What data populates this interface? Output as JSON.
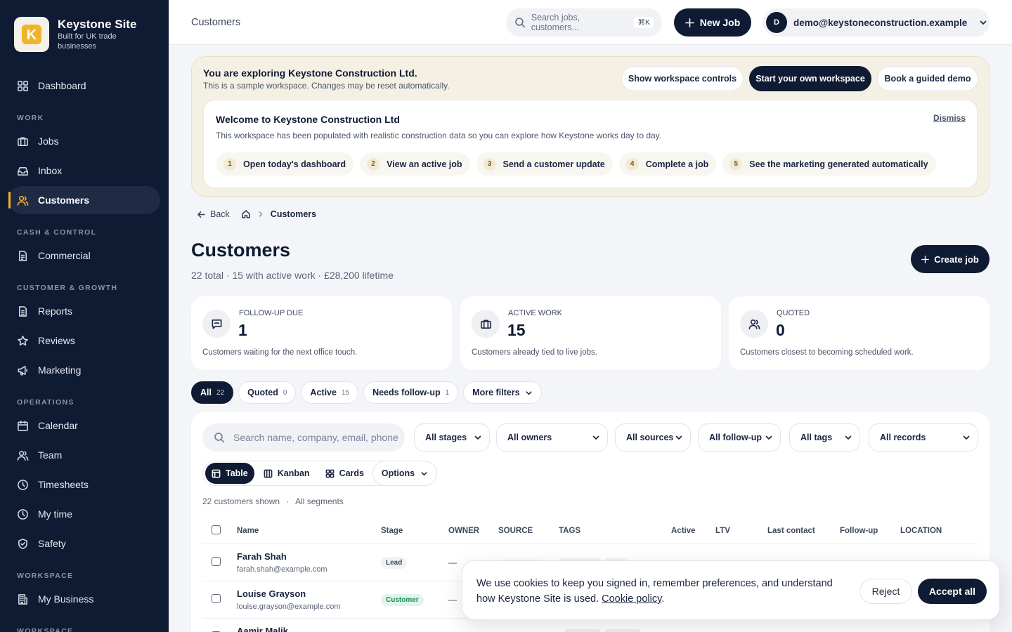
{
  "brand": {
    "name": "Keystone Site",
    "tagline": "Built for UK trade businesses",
    "logo_letter": "K"
  },
  "nav": {
    "dashboard": "Dashboard",
    "section_work": "WORK",
    "jobs": "Jobs",
    "inbox": "Inbox",
    "customers": "Customers",
    "section_cash": "CASH & CONTROL",
    "commercial": "Commercial",
    "section_growth": "CUSTOMER & GROWTH",
    "reports": "Reports",
    "reviews": "Reviews",
    "marketing": "Marketing",
    "section_ops": "OPERATIONS",
    "calendar": "Calendar",
    "team": "Team",
    "timesheets": "Timesheets",
    "my_time": "My time",
    "safety": "Safety",
    "section_workspace": "WORKSPACE",
    "my_business": "My Business",
    "section_workspace2": "WORKSPACE"
  },
  "topbar": {
    "title": "Customers",
    "search_placeholder": "Search jobs, customers...",
    "search_shortcut": "⌘K",
    "new_job": "New Job",
    "user_initial": "D",
    "user_email": "demo@keystoneconstruction.example"
  },
  "demo": {
    "title": "You are exploring Keystone Construction Ltd.",
    "subtitle": "This is a sample workspace. Changes may be reset automatically.",
    "btn_controls": "Show workspace controls",
    "btn_start": "Start your own workspace",
    "btn_demo": "Book a guided demo",
    "welcome_title": "Welcome to Keystone Construction Ltd",
    "welcome_sub": "This workspace has been populated with realistic construction data so you can explore how Keystone works day to day.",
    "dismiss": "Dismiss",
    "steps": [
      {
        "num": "1",
        "label": "Open today's dashboard"
      },
      {
        "num": "2",
        "label": "View an active job"
      },
      {
        "num": "3",
        "label": "Send a customer update"
      },
      {
        "num": "4",
        "label": "Complete a job"
      },
      {
        "num": "5",
        "label": "See the marketing generated automatically"
      }
    ]
  },
  "breadcrumb": {
    "back": "Back",
    "current": "Customers"
  },
  "page": {
    "title": "Customers",
    "subtitle": "22 total · 15 with active work · £28,200 lifetime",
    "create_job": "Create job"
  },
  "stats": [
    {
      "label": "FOLLOW-UP DUE",
      "value": "1",
      "desc": "Customers waiting for the next office touch."
    },
    {
      "label": "ACTIVE WORK",
      "value": "15",
      "desc": "Customers already tied to live jobs."
    },
    {
      "label": "QUOTED",
      "value": "0",
      "desc": "Customers closest to becoming scheduled work."
    }
  ],
  "chips": [
    {
      "label": "All",
      "count": "22"
    },
    {
      "label": "Quoted",
      "count": "0"
    },
    {
      "label": "Active",
      "count": "15"
    },
    {
      "label": "Needs follow-up",
      "count": "1"
    },
    {
      "label": "More filters",
      "count": ""
    }
  ],
  "filters": {
    "search_placeholder": "Search name, company, email, phone",
    "stages": "All stages",
    "owners": "All owners",
    "sources": "All sources",
    "followup": "All follow-up",
    "tags": "All tags",
    "records": "All records"
  },
  "views": {
    "table": "Table",
    "kanban": "Kanban",
    "cards": "Cards",
    "options": "Options"
  },
  "shown": {
    "count": "22 customers shown",
    "segment": "All segments"
  },
  "columns": {
    "name": "Name",
    "stage": "Stage",
    "owner": "OWNER",
    "source": "SOURCE",
    "tags": "TAGS",
    "active": "Active",
    "ltv": "LTV",
    "last_contact": "Last contact",
    "followup": "Follow-up",
    "location": "LOCATION"
  },
  "rows": [
    {
      "name": "Farah Shah",
      "email": "farah.shah@example.com",
      "stage": "Lead",
      "owner": "—"
    },
    {
      "name": "Louise Grayson",
      "email": "louise.grayson@example.com",
      "stage": "Customer",
      "owner": "—"
    },
    {
      "name": "Aamir Malik",
      "email": "",
      "stage": "",
      "owner": ""
    }
  ],
  "cookie": {
    "text": "We use cookies to keep you signed in, remember preferences, and understand how Keystone Site is used.",
    "link": "Cookie policy",
    "reject": "Reject",
    "accept": "Accept all"
  },
  "colors": {
    "navy": "#0f1b33",
    "accent": "#f0b429",
    "banner": "#f4f1e4",
    "customer_badge": "#dff6ea"
  }
}
